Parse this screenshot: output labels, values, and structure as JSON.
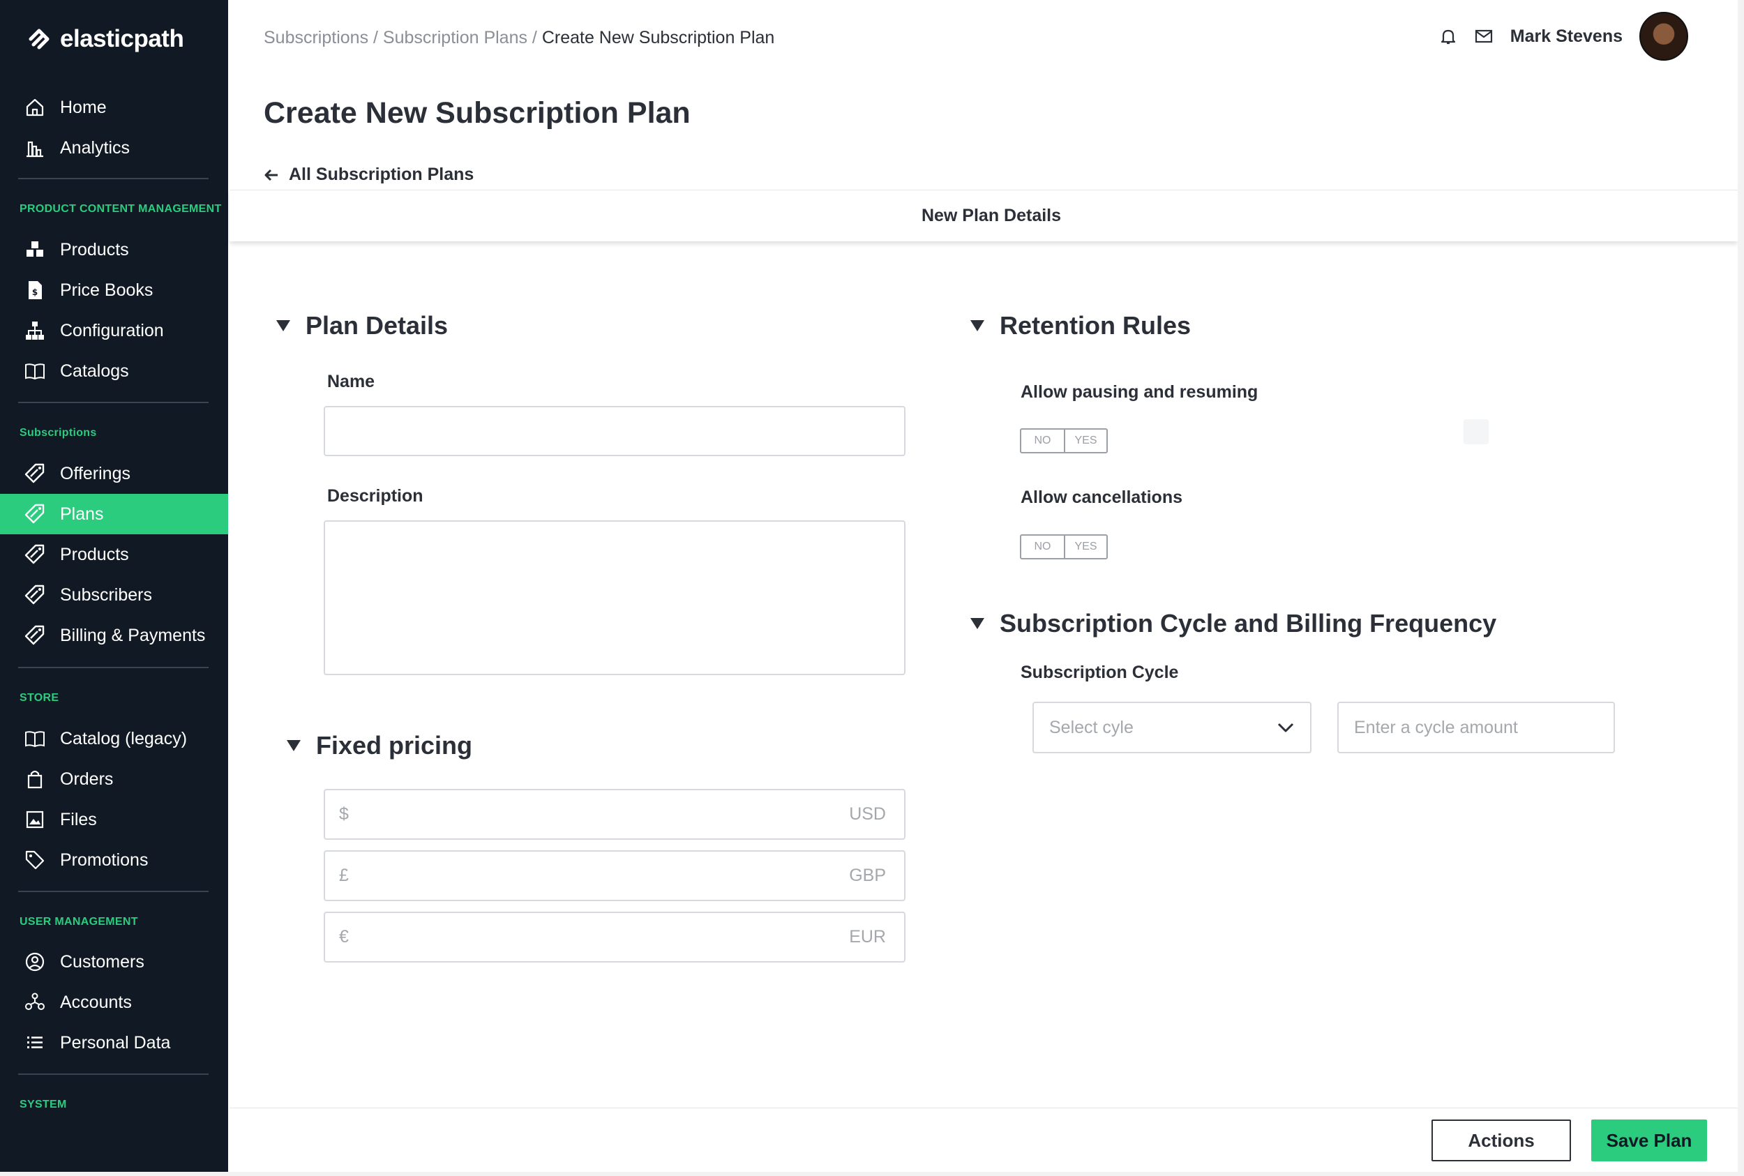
{
  "brand": {
    "name": "elasticpath",
    "icon": "elasticpath-logo-icon"
  },
  "sidebar": {
    "top_items": [
      {
        "label": "Home",
        "icon": "home-icon"
      },
      {
        "label": "Analytics",
        "icon": "analytics-icon"
      }
    ],
    "sections": [
      {
        "title": "PRODUCT CONTENT MANAGEMENT",
        "items": [
          {
            "label": "Products",
            "icon": "products-icon"
          },
          {
            "label": "Price Books",
            "icon": "price-book-icon"
          },
          {
            "label": "Configuration",
            "icon": "hierarchy-icon"
          },
          {
            "label": "Catalogs",
            "icon": "book-icon"
          }
        ]
      },
      {
        "title": "Subscriptions",
        "items": [
          {
            "label": "Offerings",
            "icon": "tag-icon"
          },
          {
            "label": "Plans",
            "icon": "tag-icon",
            "active": true
          },
          {
            "label": "Products",
            "icon": "tag-icon"
          },
          {
            "label": "Subscribers",
            "icon": "tag-icon"
          },
          {
            "label": "Billing & Payments",
            "icon": "tag-icon"
          }
        ]
      },
      {
        "title": "STORE",
        "items": [
          {
            "label": "Catalog (legacy)",
            "icon": "book-icon"
          },
          {
            "label": "Orders",
            "icon": "shopping-bag-icon"
          },
          {
            "label": "Files",
            "icon": "image-icon"
          },
          {
            "label": "Promotions",
            "icon": "tag-outline-icon"
          }
        ]
      },
      {
        "title": "USER MANAGEMENT",
        "items": [
          {
            "label": "Customers",
            "icon": "user-circle-icon"
          },
          {
            "label": "Accounts",
            "icon": "accounts-icon"
          },
          {
            "label": "Personal Data",
            "icon": "list-icon"
          }
        ]
      },
      {
        "title": "SYSTEM",
        "items": []
      }
    ]
  },
  "breadcrumb": {
    "items": [
      "Subscriptions",
      "Subscription Plans"
    ],
    "separator": " / ",
    "current": "Create New Subscription Plan"
  },
  "header": {
    "user_name": "Mark Stevens",
    "notification_icon": "bell-icon",
    "mail_icon": "mail-icon"
  },
  "page": {
    "title": "Create New Subscription Plan",
    "back_link": "All Subscription Plans",
    "tab": "New Plan Details"
  },
  "plan_details": {
    "heading": "Plan Details",
    "name_label": "Name",
    "name_value": "",
    "description_label": "Description",
    "description_value": ""
  },
  "fixed_pricing": {
    "heading": "Fixed pricing",
    "currencies": [
      {
        "symbol": "$",
        "code": "USD"
      },
      {
        "symbol": "£",
        "code": "GBP"
      },
      {
        "symbol": "€",
        "code": "EUR"
      }
    ]
  },
  "retention_rules": {
    "heading": "Retention Rules",
    "pausing_label": "Allow pausing and resuming",
    "cancellations_label": "Allow cancellations",
    "toggle_no": "NO",
    "toggle_yes": "YES"
  },
  "subscription_cycle": {
    "heading": "Subscription Cycle and Billing Frequency",
    "cycle_label": "Subscription Cycle",
    "select_placeholder": "Select cyle",
    "amount_placeholder": "Enter a cycle amount"
  },
  "footer": {
    "actions_label": "Actions",
    "save_label": "Save Plan"
  },
  "colors": {
    "sidebar_bg": "#111a24",
    "accent": "#2bcc7e",
    "text": "#2b2f38"
  }
}
